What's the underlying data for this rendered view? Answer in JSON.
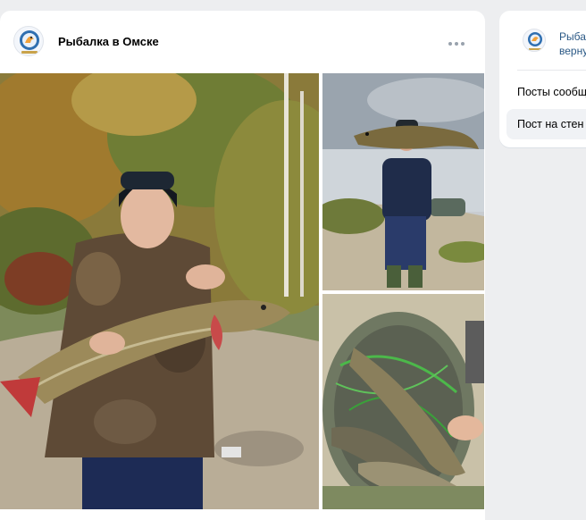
{
  "post": {
    "group_name": "Рыбалка в Омске",
    "avatar_icon": "fish-logo-icon",
    "more_icon": "more-dots-icon",
    "photos": [
      {
        "name": "photo-man-holding-pike"
      },
      {
        "name": "photo-man-pike-lake"
      },
      {
        "name": "photo-pikes-in-basin"
      }
    ]
  },
  "sidebar": {
    "title_line1": "Рыба",
    "title_line2": "верну",
    "items": [
      {
        "label": "Посты сообщ"
      },
      {
        "label": "Пост на стен"
      }
    ]
  },
  "colors": {
    "background": "#edeef0",
    "card": "#ffffff",
    "link": "#2a5885",
    "selected_item": "#f0f2f5"
  }
}
